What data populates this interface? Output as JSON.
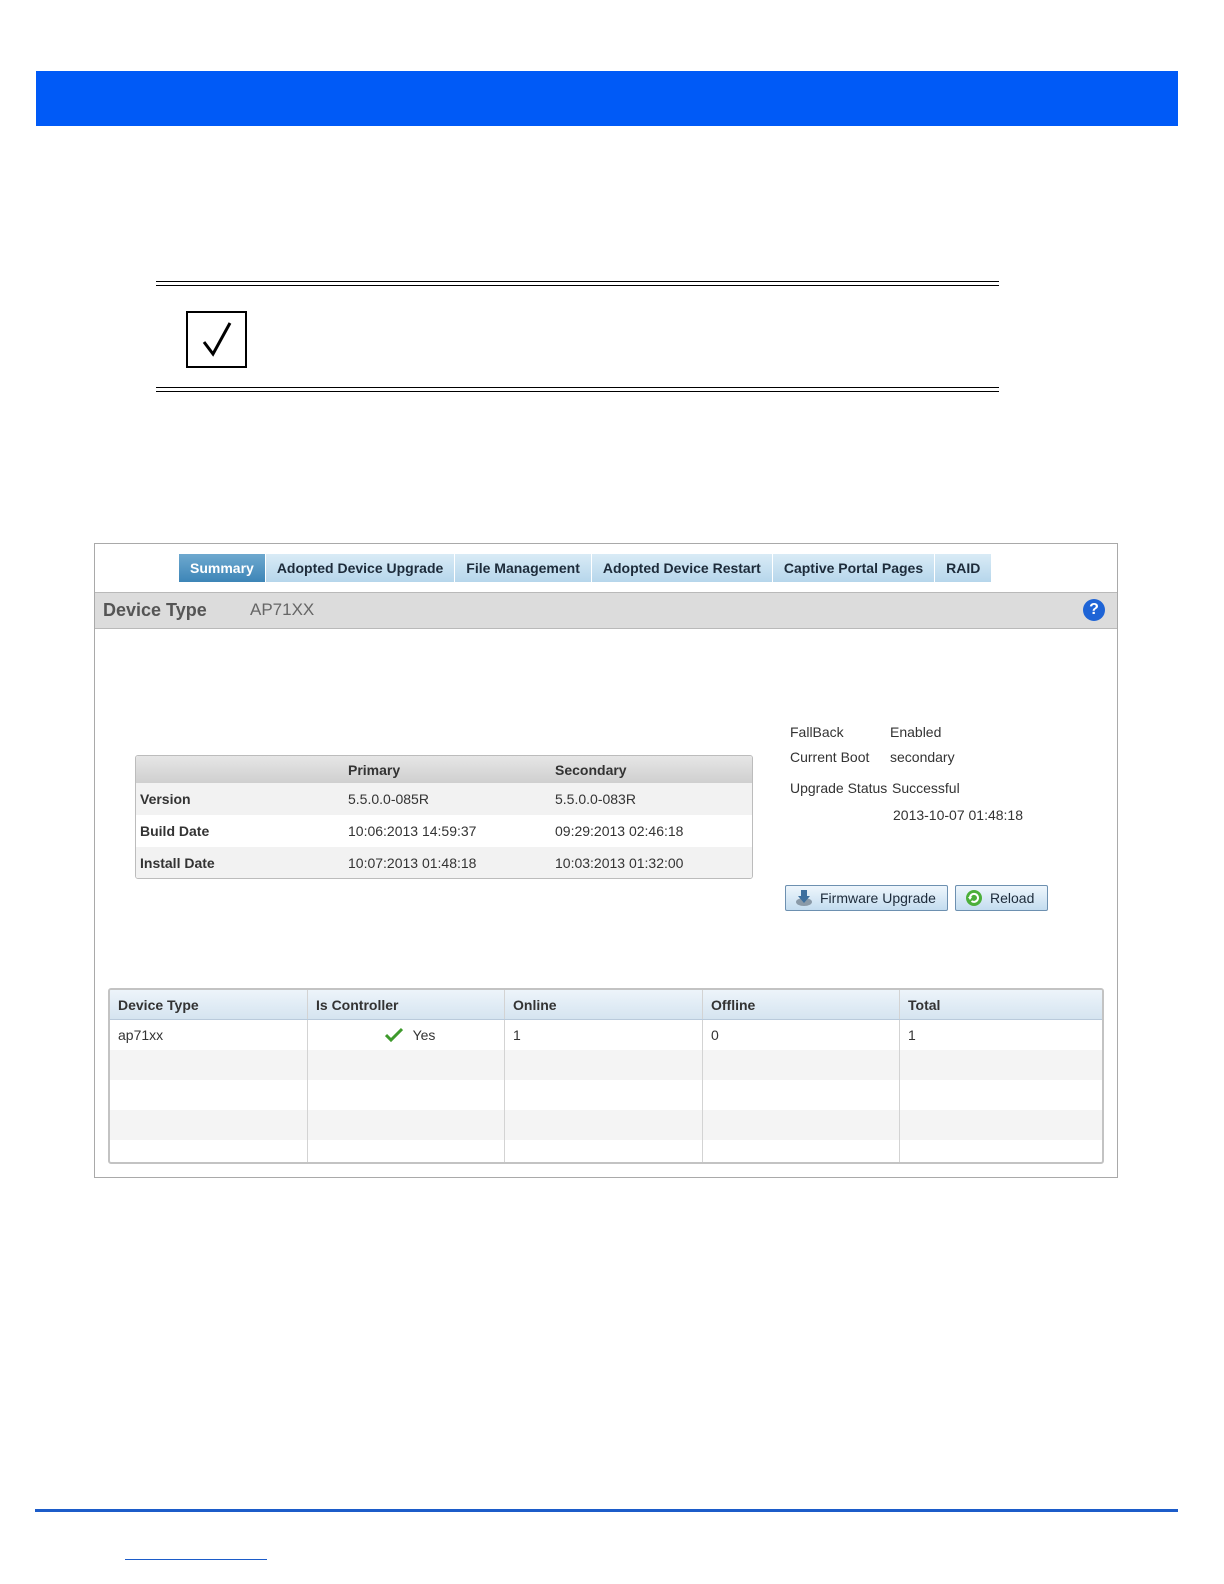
{
  "tabs": [
    {
      "label": "Summary",
      "active": true
    },
    {
      "label": "Adopted Device Upgrade",
      "active": false
    },
    {
      "label": "File Management",
      "active": false
    },
    {
      "label": "Adopted Device Restart",
      "active": false
    },
    {
      "label": "Captive Portal Pages",
      "active": false
    },
    {
      "label": "RAID",
      "active": false
    }
  ],
  "device_bar": {
    "label": "Device Type",
    "value": "AP71XX",
    "help_icon": "question-mark-icon"
  },
  "firmware_table": {
    "headers": [
      "",
      "Primary",
      "Secondary"
    ],
    "rows": [
      [
        "Version",
        "5.5.0.0-085R",
        "5.5.0.0-083R"
      ],
      [
        "Build Date",
        "10:06:2013 14:59:37",
        "09:29:2013 02:46:18"
      ],
      [
        "Install Date",
        "10:07:2013 01:48:18",
        "10:03:2013 01:32:00"
      ]
    ]
  },
  "status": {
    "fallback_label": "FallBack",
    "fallback_value": "Enabled",
    "current_boot_label": "Current Boot",
    "current_boot_value": "secondary",
    "upgrade_status_label": "Upgrade Status",
    "upgrade_status_value": "Successful",
    "upgrade_time": "2013-10-07 01:48:18"
  },
  "buttons": {
    "firmware_upgrade": "Firmware Upgrade",
    "reload": "Reload"
  },
  "device_table": {
    "headers": [
      "Device Type",
      "Is Controller",
      "Online",
      "Offline",
      "Total"
    ],
    "rows": [
      {
        "device_type": "ap71xx",
        "is_controller": "Yes",
        "online": "1",
        "offline": "0",
        "total": "1"
      }
    ]
  },
  "colors": {
    "banner": "#005af7",
    "accent": "#1c5cc9"
  }
}
